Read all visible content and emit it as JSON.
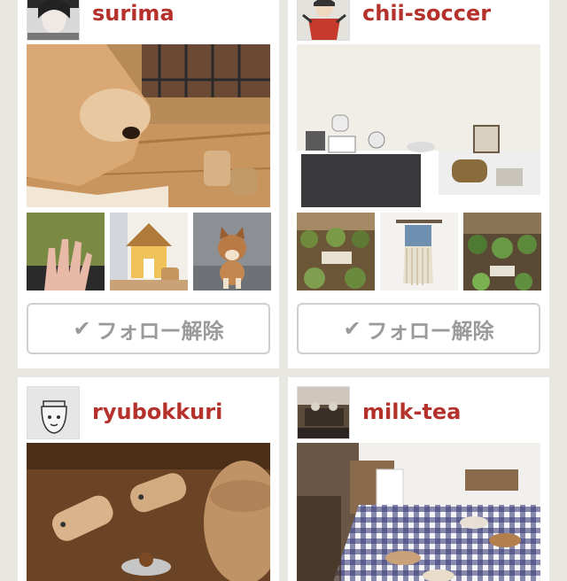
{
  "cards": [
    {
      "username": "surima",
      "follow_label": "フォロー解除",
      "follow_icon": "check-icon"
    },
    {
      "username": "chii-soccer",
      "follow_label": "フォロー解除",
      "follow_icon": "check-icon"
    },
    {
      "username": "ryubokkuri"
    },
    {
      "username": "milk-tea"
    }
  ],
  "colors": {
    "username": "#b5322c",
    "button_text": "#9a9a9a",
    "background": "#e9e7e2"
  }
}
